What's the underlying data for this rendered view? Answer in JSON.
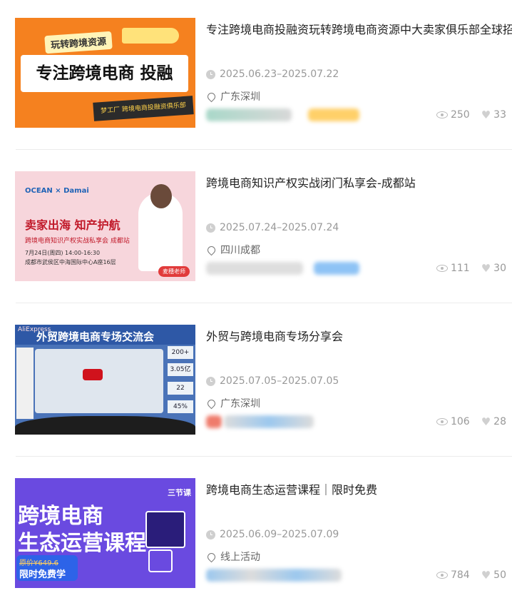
{
  "events": [
    {
      "title": "专注跨境电商投融资玩转跨境电商资源中大卖家俱乐部全球招",
      "date": "2025.06.23–2025.07.22",
      "location": "广东深圳",
      "views": "250",
      "likes": "33",
      "thumb": {
        "tag": "玩转跨境资源",
        "headline": "专注跨境电商 投融",
        "footer": "梦工厂 跨境电商投融资俱乐部"
      }
    },
    {
      "title": "跨境电商知识产权实战闭门私享会-成都站",
      "date": "2025.07.24–2025.07.24",
      "location": "四川成都",
      "views": "111",
      "likes": "30",
      "thumb": {
        "logo": "OCEAN × Damai",
        "headline": "卖家出海  知产护航",
        "subhead": "跨境电商知识产权实战私享会 成都站",
        "info_date": "7月24日(周四) 14:00-16:30",
        "info_place": "成都市武侯区中海国际中心A座16层",
        "badge": "麦穗老师"
      }
    },
    {
      "title": "外贸与跨境电商专场分享会",
      "date": "2025.07.05–2025.07.05",
      "location": "广东深圳",
      "views": "106",
      "likes": "28",
      "thumb": {
        "brand": "AliExpress",
        "headline": "外贸跨境电商专场交流会",
        "stat1": "200+",
        "stat2": "3.05亿",
        "stat3": "22",
        "stat4": "45%"
      }
    },
    {
      "title": "跨境电商生态运营课程｜限时免费",
      "date": "2025.06.09–2025.07.09",
      "location": "线上活动",
      "views": "784",
      "likes": "50",
      "thumb": {
        "line1": "跨境电商",
        "line2": "生态运营课程",
        "price_old": "原价¥649.6",
        "price_new": "限时免费学",
        "brand": "三节课"
      }
    }
  ],
  "colors": {
    "meta_gray": "#999999",
    "thumb1_bg": "#f5811f",
    "thumb2_bg": "#f7d6dc",
    "thumb3_bg": "#4a73b8",
    "thumb4_bg": "#6a4ae0"
  },
  "icons": {
    "date": "clock-icon",
    "location": "location-pin-icon",
    "views": "eye-icon",
    "likes": "heart-icon"
  }
}
